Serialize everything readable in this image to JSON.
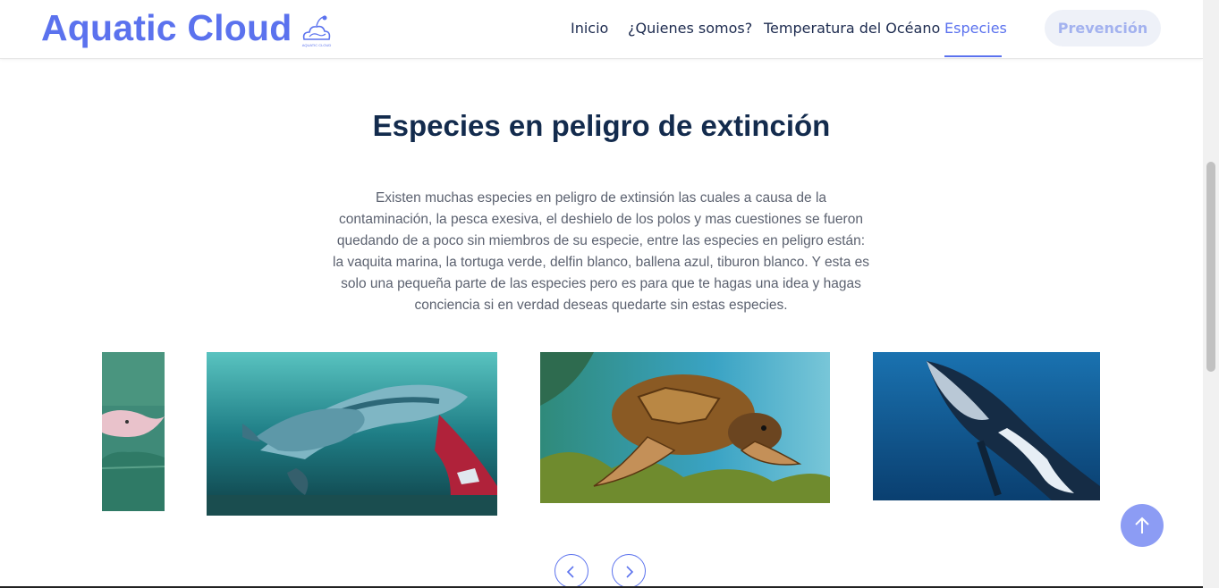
{
  "header": {
    "logo_text": "Aquatic Cloud",
    "logo_icon": "whale-cloud-logo-icon",
    "logo_caption": "AQUATIC CLOUD",
    "nav": [
      {
        "label": "Inicio",
        "active": false
      },
      {
        "label": "¿Quienes somos?",
        "active": false
      },
      {
        "label": "Temperatura del Océano",
        "active": false
      },
      {
        "label": "Especies",
        "active": true
      }
    ],
    "cta_label": "Prevención"
  },
  "section": {
    "title": "Especies en peligro de extinción",
    "description": "Existen muchas especies en peligro de extinsión las cuales a causa de la contaminación, la pesca exesiva, el deshielo de los polos y mas cuestiones se fueron quedando de a poco sin miembros de su especie, entre las especies en peligro están: la vaquita marina, la tortuga verde, delfin blanco, ballena azul, tiburon blanco. Y esta es solo una pequeña parte de las especies pero es para que te hagas una idea y hagas conciencia si en verdad deseas quedarte sin estas especies."
  },
  "carousel": {
    "slides": [
      "pink-dolphin",
      "vaquita-marina",
      "sea-turtle",
      "humpback-whale"
    ],
    "prev_icon": "chevron-left-icon",
    "next_icon": "chevron-right-icon"
  },
  "back_to_top_icon": "arrow-up-icon",
  "colors": {
    "accent": "#5b72ee",
    "title": "#132b4d",
    "text": "#5c6270",
    "ocean": "#1c6fa0"
  }
}
